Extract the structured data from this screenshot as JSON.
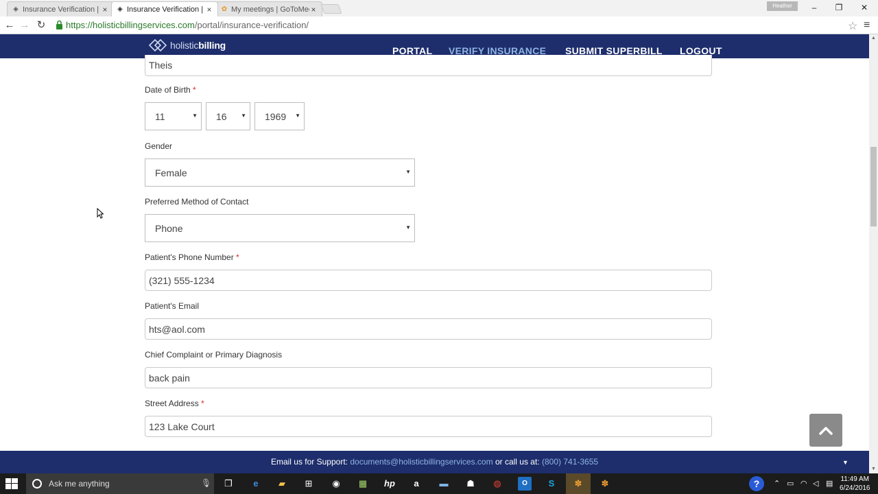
{
  "browser": {
    "tabs": [
      {
        "title": "Insurance Verification | Ho",
        "icon": "globe-icon",
        "active": false
      },
      {
        "title": "Insurance Verification | Ho",
        "icon": "globe-icon",
        "active": true
      },
      {
        "title": "My meetings | GoToMeeti",
        "icon": "gotomeeting-icon",
        "active": false
      }
    ],
    "profile_name": "Heather",
    "url_host": "https://holisticbillingservices.com",
    "url_path": "/portal/insurance-verification/"
  },
  "site": {
    "logo_light": "holistic",
    "logo_bold": "billing",
    "nav": [
      {
        "label": "PORTAL",
        "active": false
      },
      {
        "label": "VERIFY INSURANCE",
        "active": true
      },
      {
        "label": "SUBMIT SUPERBILL",
        "active": false
      },
      {
        "label": "LOGOUT",
        "active": false
      }
    ],
    "brand_color": "#1e2e6c",
    "accent_color": "#8fb4e4"
  },
  "form": {
    "last_name_value": "Theis",
    "dob_label": "Date of Birth",
    "dob_month": "11",
    "dob_day": "16",
    "dob_year": "1969",
    "gender_label": "Gender",
    "gender_value": "Female",
    "contact_label": "Preferred Method of Contact",
    "contact_value": "Phone",
    "phone_label": "Patient's Phone Number",
    "phone_value": "(321) 555-1234",
    "email_label": "Patient's Email",
    "email_value": "hts@aol.com",
    "complaint_label": "Chief Complaint or Primary Diagnosis",
    "complaint_value": "back pain",
    "street_label": "Street Address",
    "street_value": "123 Lake Court",
    "required_mark": "*"
  },
  "footer": {
    "prefix": "Email us for Support:",
    "email": "documents@holisticbillingservices.com",
    "middle": "or call us at:",
    "phone": "(800) 741-3655"
  },
  "taskbar": {
    "search_placeholder": "Ask me anything",
    "time": "11:49 AM",
    "date": "6/24/2016"
  }
}
